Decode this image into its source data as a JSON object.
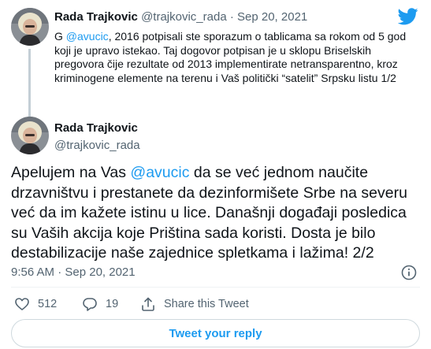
{
  "parent_tweet": {
    "display_name": "Rada Trajkovic",
    "handle": "@trajkovic_rada",
    "separator": "·",
    "date": "Sep 20, 2021",
    "text_prefix": "G ",
    "mention": "@avucic",
    "text_rest": ", 2016 potpisali ste sporazum o tablicama sa rokom od 5 god koji je upravo istekao. Taj dogovor potpisan je u sklopu Briselskih pregovora čije rezultate od 2013 implementirate netransparentno, kroz kriminogene elemente na terenu i Vaš politički “satelit” Srpsku listu 1/2"
  },
  "main_tweet": {
    "display_name": "Rada Trajkovic",
    "handle": "@trajkovic_rada",
    "text_prefix": "Apelujem na Vas ",
    "mention": "@avucic",
    "text_rest": " da se već jednom naučite drzavništvu i prestanete da dezinformišete Srbe na severu već da im kažete istinu u lice. Današnji događaji posledica su Vaših akcija koje Priština sada koristi. Dosta je bilo destabilizacije naše zajednice spletkama i lažima! 2/2",
    "timestamp": "9:56 AM · Sep 20, 2021"
  },
  "actions": {
    "like_count": "512",
    "reply_count": "19",
    "share_label": "Share this Tweet"
  },
  "reply_button_label": "Tweet your reply",
  "icons": {
    "brand": "twitter-bird-icon",
    "info": "info-icon",
    "like": "heart-icon",
    "reply": "comment-icon",
    "share": "share-icon"
  },
  "colors": {
    "accent": "#1d9bf0",
    "text": "#0f1419",
    "muted": "#536471"
  }
}
